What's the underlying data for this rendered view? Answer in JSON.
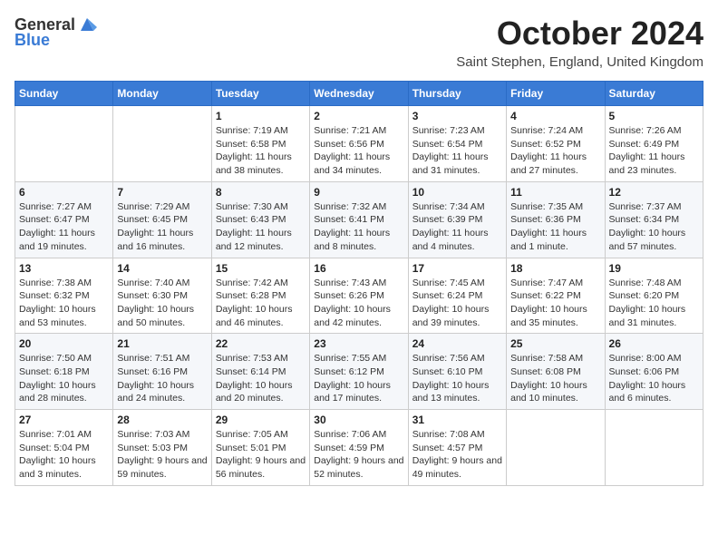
{
  "header": {
    "logo_general": "General",
    "logo_blue": "Blue",
    "month_title": "October 2024",
    "location": "Saint Stephen, England, United Kingdom"
  },
  "days_of_week": [
    "Sunday",
    "Monday",
    "Tuesday",
    "Wednesday",
    "Thursday",
    "Friday",
    "Saturday"
  ],
  "weeks": [
    [
      {
        "day": null
      },
      {
        "day": null
      },
      {
        "day": "1",
        "sunrise": "Sunrise: 7:19 AM",
        "sunset": "Sunset: 6:58 PM",
        "daylight": "Daylight: 11 hours and 38 minutes."
      },
      {
        "day": "2",
        "sunrise": "Sunrise: 7:21 AM",
        "sunset": "Sunset: 6:56 PM",
        "daylight": "Daylight: 11 hours and 34 minutes."
      },
      {
        "day": "3",
        "sunrise": "Sunrise: 7:23 AM",
        "sunset": "Sunset: 6:54 PM",
        "daylight": "Daylight: 11 hours and 31 minutes."
      },
      {
        "day": "4",
        "sunrise": "Sunrise: 7:24 AM",
        "sunset": "Sunset: 6:52 PM",
        "daylight": "Daylight: 11 hours and 27 minutes."
      },
      {
        "day": "5",
        "sunrise": "Sunrise: 7:26 AM",
        "sunset": "Sunset: 6:49 PM",
        "daylight": "Daylight: 11 hours and 23 minutes."
      }
    ],
    [
      {
        "day": "6",
        "sunrise": "Sunrise: 7:27 AM",
        "sunset": "Sunset: 6:47 PM",
        "daylight": "Daylight: 11 hours and 19 minutes."
      },
      {
        "day": "7",
        "sunrise": "Sunrise: 7:29 AM",
        "sunset": "Sunset: 6:45 PM",
        "daylight": "Daylight: 11 hours and 16 minutes."
      },
      {
        "day": "8",
        "sunrise": "Sunrise: 7:30 AM",
        "sunset": "Sunset: 6:43 PM",
        "daylight": "Daylight: 11 hours and 12 minutes."
      },
      {
        "day": "9",
        "sunrise": "Sunrise: 7:32 AM",
        "sunset": "Sunset: 6:41 PM",
        "daylight": "Daylight: 11 hours and 8 minutes."
      },
      {
        "day": "10",
        "sunrise": "Sunrise: 7:34 AM",
        "sunset": "Sunset: 6:39 PM",
        "daylight": "Daylight: 11 hours and 4 minutes."
      },
      {
        "day": "11",
        "sunrise": "Sunrise: 7:35 AM",
        "sunset": "Sunset: 6:36 PM",
        "daylight": "Daylight: 11 hours and 1 minute."
      },
      {
        "day": "12",
        "sunrise": "Sunrise: 7:37 AM",
        "sunset": "Sunset: 6:34 PM",
        "daylight": "Daylight: 10 hours and 57 minutes."
      }
    ],
    [
      {
        "day": "13",
        "sunrise": "Sunrise: 7:38 AM",
        "sunset": "Sunset: 6:32 PM",
        "daylight": "Daylight: 10 hours and 53 minutes."
      },
      {
        "day": "14",
        "sunrise": "Sunrise: 7:40 AM",
        "sunset": "Sunset: 6:30 PM",
        "daylight": "Daylight: 10 hours and 50 minutes."
      },
      {
        "day": "15",
        "sunrise": "Sunrise: 7:42 AM",
        "sunset": "Sunset: 6:28 PM",
        "daylight": "Daylight: 10 hours and 46 minutes."
      },
      {
        "day": "16",
        "sunrise": "Sunrise: 7:43 AM",
        "sunset": "Sunset: 6:26 PM",
        "daylight": "Daylight: 10 hours and 42 minutes."
      },
      {
        "day": "17",
        "sunrise": "Sunrise: 7:45 AM",
        "sunset": "Sunset: 6:24 PM",
        "daylight": "Daylight: 10 hours and 39 minutes."
      },
      {
        "day": "18",
        "sunrise": "Sunrise: 7:47 AM",
        "sunset": "Sunset: 6:22 PM",
        "daylight": "Daylight: 10 hours and 35 minutes."
      },
      {
        "day": "19",
        "sunrise": "Sunrise: 7:48 AM",
        "sunset": "Sunset: 6:20 PM",
        "daylight": "Daylight: 10 hours and 31 minutes."
      }
    ],
    [
      {
        "day": "20",
        "sunrise": "Sunrise: 7:50 AM",
        "sunset": "Sunset: 6:18 PM",
        "daylight": "Daylight: 10 hours and 28 minutes."
      },
      {
        "day": "21",
        "sunrise": "Sunrise: 7:51 AM",
        "sunset": "Sunset: 6:16 PM",
        "daylight": "Daylight: 10 hours and 24 minutes."
      },
      {
        "day": "22",
        "sunrise": "Sunrise: 7:53 AM",
        "sunset": "Sunset: 6:14 PM",
        "daylight": "Daylight: 10 hours and 20 minutes."
      },
      {
        "day": "23",
        "sunrise": "Sunrise: 7:55 AM",
        "sunset": "Sunset: 6:12 PM",
        "daylight": "Daylight: 10 hours and 17 minutes."
      },
      {
        "day": "24",
        "sunrise": "Sunrise: 7:56 AM",
        "sunset": "Sunset: 6:10 PM",
        "daylight": "Daylight: 10 hours and 13 minutes."
      },
      {
        "day": "25",
        "sunrise": "Sunrise: 7:58 AM",
        "sunset": "Sunset: 6:08 PM",
        "daylight": "Daylight: 10 hours and 10 minutes."
      },
      {
        "day": "26",
        "sunrise": "Sunrise: 8:00 AM",
        "sunset": "Sunset: 6:06 PM",
        "daylight": "Daylight: 10 hours and 6 minutes."
      }
    ],
    [
      {
        "day": "27",
        "sunrise": "Sunrise: 7:01 AM",
        "sunset": "Sunset: 5:04 PM",
        "daylight": "Daylight: 10 hours and 3 minutes."
      },
      {
        "day": "28",
        "sunrise": "Sunrise: 7:03 AM",
        "sunset": "Sunset: 5:03 PM",
        "daylight": "Daylight: 9 hours and 59 minutes."
      },
      {
        "day": "29",
        "sunrise": "Sunrise: 7:05 AM",
        "sunset": "Sunset: 5:01 PM",
        "daylight": "Daylight: 9 hours and 56 minutes."
      },
      {
        "day": "30",
        "sunrise": "Sunrise: 7:06 AM",
        "sunset": "Sunset: 4:59 PM",
        "daylight": "Daylight: 9 hours and 52 minutes."
      },
      {
        "day": "31",
        "sunrise": "Sunrise: 7:08 AM",
        "sunset": "Sunset: 4:57 PM",
        "daylight": "Daylight: 9 hours and 49 minutes."
      },
      {
        "day": null
      },
      {
        "day": null
      }
    ]
  ]
}
